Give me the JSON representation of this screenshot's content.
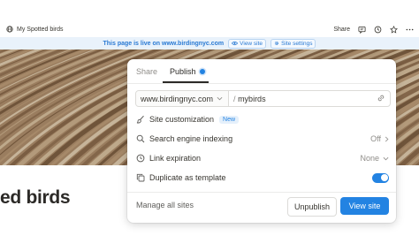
{
  "topbar": {
    "page_title": "My Spotted birds",
    "share_label": "Share"
  },
  "banner": {
    "message": "This page is live on www.birdingnyc.com",
    "view_site": "View site",
    "site_settings": "Site settings"
  },
  "page": {
    "heading": "ed birds"
  },
  "publish_panel": {
    "tabs": {
      "share": "Share",
      "publish": "Publish"
    },
    "domain": "www.birdingnyc.com",
    "slug_separator": "/",
    "slug": "mybirds",
    "rows": {
      "customization": {
        "label": "Site customization",
        "badge": "New"
      },
      "indexing": {
        "label": "Search engine indexing",
        "value": "Off"
      },
      "expiration": {
        "label": "Link expiration",
        "value": "None"
      },
      "duplicate": {
        "label": "Duplicate as template",
        "enabled": true
      }
    },
    "manage_label": "Manage all sites",
    "unpublish_label": "Unpublish",
    "view_site_label": "View site"
  },
  "colors": {
    "accent": "#2383e2",
    "banner_bg": "#e9f2fb",
    "banner_text": "#2a7ad3"
  },
  "icons": [
    "globe-icon",
    "comment-icon",
    "clock-icon",
    "star-icon",
    "more-icon",
    "eye-icon",
    "gear-icon",
    "chevron-down-icon",
    "link-icon",
    "brush-icon",
    "search-icon",
    "duplicate-icon",
    "chevron-right-icon"
  ]
}
